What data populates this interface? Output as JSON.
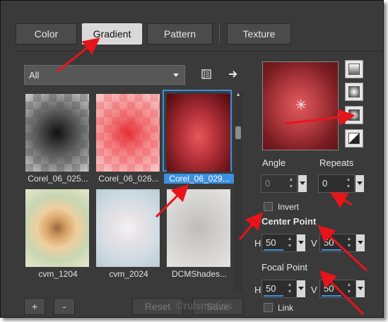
{
  "tabs": [
    {
      "label": "Color"
    },
    {
      "label": "Gradient"
    },
    {
      "label": "Pattern"
    },
    {
      "label": "Texture"
    }
  ],
  "category_dropdown": {
    "value": "All"
  },
  "thumbnails": [
    {
      "label": "Corel_06_025..."
    },
    {
      "label": "Corel_06_026..."
    },
    {
      "label": "Corel_06_029..."
    },
    {
      "label": "cvm_1204"
    },
    {
      "label": "cvm_2024"
    },
    {
      "label": "DCMShades..."
    }
  ],
  "angle": {
    "label": "Angle",
    "value": "0"
  },
  "repeats": {
    "label": "Repeats",
    "value": "0"
  },
  "invert": {
    "label": "Invert"
  },
  "center_point": {
    "label": "Center Point",
    "h_label": "H",
    "h_value": "50",
    "v_label": "V",
    "v_value": "50"
  },
  "focal_point": {
    "label": "Focal Point",
    "h_label": "H",
    "h_value": "50",
    "v_label": "V",
    "v_value": "50"
  },
  "link": {
    "label": "Link"
  },
  "buttons": {
    "add": "+",
    "remove": "-",
    "reset": "Reset",
    "save": "Save"
  },
  "watermark": "©rulsmatios",
  "colors": {
    "accent": "#3d8fe0",
    "arrow": "#e8141c",
    "background": "#3a3a3a"
  }
}
